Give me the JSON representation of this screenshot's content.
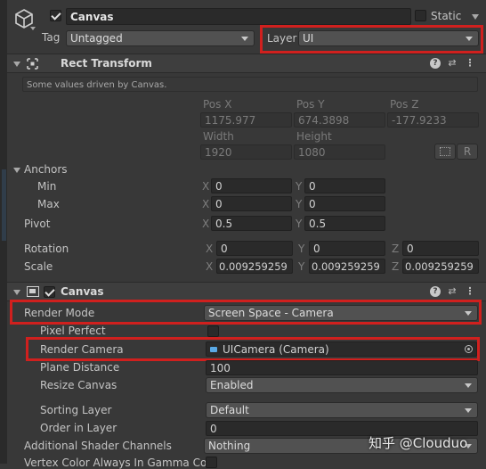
{
  "object": {
    "name": "Canvas",
    "static_label": "Static",
    "tag_label": "Tag",
    "tag_value": "Untagged",
    "layer_label": "Layer",
    "layer_value": "UI"
  },
  "rect_transform": {
    "title": "Rect Transform",
    "info": "Some values driven by Canvas.",
    "pos_x_label": "Pos X",
    "pos_y_label": "Pos Y",
    "pos_z_label": "Pos Z",
    "pos_x": "1175.977",
    "pos_y": "674.3898",
    "pos_z": "-177.9233",
    "width_label": "Width",
    "height_label": "Height",
    "width": "1920",
    "height": "1080",
    "r_button": "R",
    "anchors_label": "Anchors",
    "min_label": "Min",
    "max_label": "Max",
    "min_x": "0",
    "min_y": "0",
    "max_x": "0",
    "max_y": "0",
    "pivot_label": "Pivot",
    "pivot_x": "0.5",
    "pivot_y": "0.5",
    "rotation_label": "Rotation",
    "rot_x": "0",
    "rot_y": "0",
    "rot_z": "0",
    "scale_label": "Scale",
    "scale_x": "0.009259259",
    "scale_y": "0.009259259",
    "scale_z": "0.009259259",
    "x": "X",
    "y": "Y",
    "z": "Z"
  },
  "canvas": {
    "title": "Canvas",
    "render_mode_label": "Render Mode",
    "render_mode": "Screen Space - Camera",
    "pixel_perfect_label": "Pixel Perfect",
    "render_camera_label": "Render Camera",
    "render_camera": "UICamera (Camera)",
    "plane_distance_label": "Plane Distance",
    "plane_distance": "100",
    "resize_canvas_label": "Resize Canvas",
    "resize_canvas": "Enabled",
    "sorting_layer_label": "Sorting Layer",
    "sorting_layer": "Default",
    "order_in_layer_label": "Order in Layer",
    "order_in_layer": "0",
    "shader_channels_label": "Additional Shader Channels",
    "shader_channels": "Nothing",
    "vertex_color_label": "Vertex Color Always In Gamma Colo"
  },
  "watermark": "知乎 @Clouduo",
  "colors": {
    "highlight": "#d0201e",
    "panel": "#383838",
    "field": "#2a2a2a"
  }
}
